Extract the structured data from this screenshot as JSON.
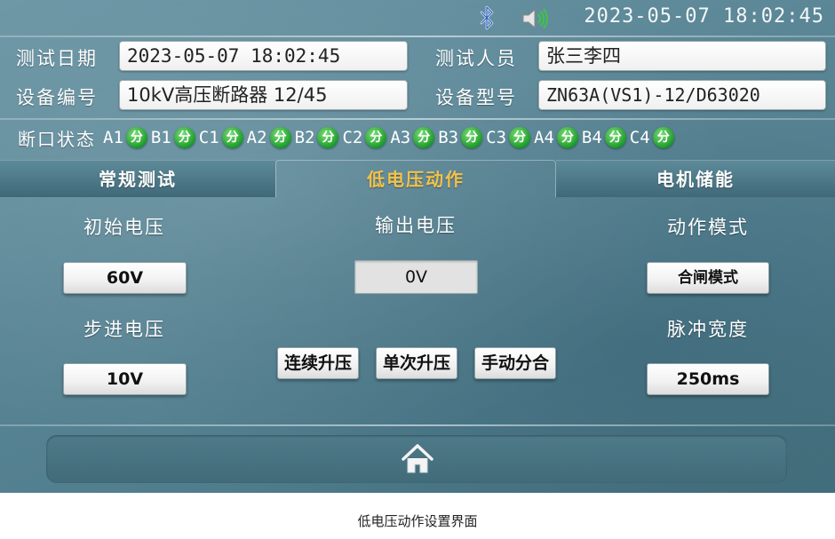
{
  "status_bar": {
    "datetime": "2023-05-07  18:02:45",
    "bluetooth_icon": "bluetooth-icon",
    "speaker_icon": "speaker-icon"
  },
  "header": {
    "test_date_label": "测试日期",
    "test_date_value": "2023-05-07  18:02:45",
    "tester_label": "测试人员",
    "tester_value": "张三李四",
    "device_id_label": "设备编号",
    "device_id_value": "10kV高压断路器  12/45",
    "device_model_label": "设备型号",
    "device_model_value": "ZN63A(VS1)-12/D63020"
  },
  "breaker_status": {
    "title": "断口状态",
    "items": [
      {
        "name": "A1",
        "state": "分"
      },
      {
        "name": "B1",
        "state": "分"
      },
      {
        "name": "C1",
        "state": "分"
      },
      {
        "name": "A2",
        "state": "分"
      },
      {
        "name": "B2",
        "state": "分"
      },
      {
        "name": "C2",
        "state": "分"
      },
      {
        "name": "A3",
        "state": "分"
      },
      {
        "name": "B3",
        "state": "分"
      },
      {
        "name": "C3",
        "state": "分"
      },
      {
        "name": "A4",
        "state": "分"
      },
      {
        "name": "B4",
        "state": "分"
      },
      {
        "name": "C4",
        "state": "分"
      }
    ],
    "state_color": "#1c9a2a"
  },
  "tabs": [
    {
      "label": "常规测试",
      "active": false
    },
    {
      "label": "低电压动作",
      "active": true
    },
    {
      "label": "电机储能",
      "active": false
    }
  ],
  "active_tab_color": "#f2c24a",
  "main": {
    "initial_voltage_label": "初始电压",
    "initial_voltage_value": "60V",
    "step_voltage_label": "步进电压",
    "step_voltage_value": "10V",
    "output_voltage_label": "输出电压",
    "output_voltage_value": "0V",
    "continuous_boost_label": "连续升压",
    "single_boost_label": "单次升压",
    "manual_open_close_label": "手动分合",
    "action_mode_label": "动作模式",
    "action_mode_value": "合闸模式",
    "pulse_width_label": "脉冲宽度",
    "pulse_width_value": "250ms"
  },
  "footer": {
    "home_icon": "home-icon"
  },
  "caption": "低电压动作设置界面"
}
